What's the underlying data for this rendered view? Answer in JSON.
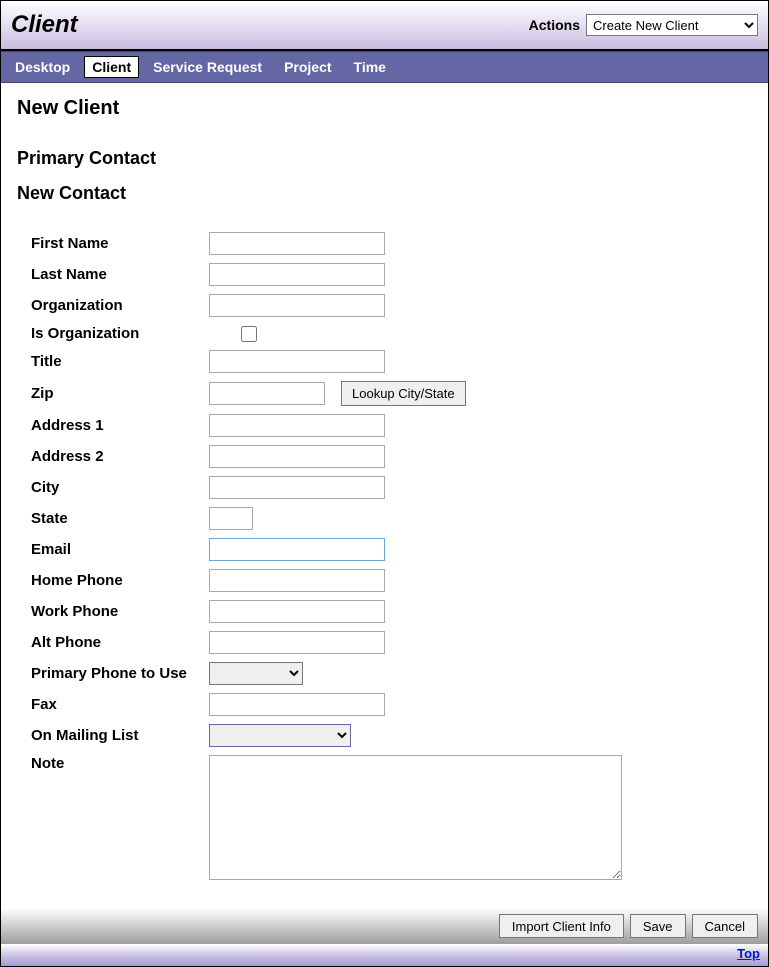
{
  "header": {
    "title": "Client",
    "actions_label": "Actions",
    "actions_selected": "Create New Client"
  },
  "nav": {
    "items": [
      {
        "label": "Desktop",
        "active": false
      },
      {
        "label": "Client",
        "active": true
      },
      {
        "label": "Service Request",
        "active": false
      },
      {
        "label": "Project",
        "active": false
      },
      {
        "label": "Time",
        "active": false
      }
    ]
  },
  "page": {
    "h_new_client": "New Client",
    "h_primary_contact": "Primary Contact",
    "h_new_contact": "New Contact"
  },
  "form": {
    "first_name": {
      "label": "First Name",
      "value": ""
    },
    "last_name": {
      "label": "Last Name",
      "value": ""
    },
    "organization": {
      "label": "Organization",
      "value": ""
    },
    "is_organization": {
      "label": "Is Organization"
    },
    "title": {
      "label": "Title",
      "value": ""
    },
    "zip": {
      "label": "Zip",
      "value": "",
      "lookup_button": "Lookup City/State"
    },
    "address1": {
      "label": "Address 1",
      "value": ""
    },
    "address2": {
      "label": "Address 2",
      "value": ""
    },
    "city": {
      "label": "City",
      "value": ""
    },
    "state": {
      "label": "State",
      "value": ""
    },
    "email": {
      "label": "Email",
      "value": ""
    },
    "home_phone": {
      "label": "Home Phone",
      "value": ""
    },
    "work_phone": {
      "label": "Work Phone",
      "value": ""
    },
    "alt_phone": {
      "label": "Alt Phone",
      "value": ""
    },
    "primary_phone": {
      "label": "Primary Phone to Use",
      "value": ""
    },
    "fax": {
      "label": "Fax",
      "value": ""
    },
    "mailing_list": {
      "label": "On Mailing List",
      "value": ""
    },
    "note": {
      "label": "Note",
      "value": ""
    }
  },
  "footer": {
    "import_button": "Import Client Info",
    "save_button": "Save",
    "cancel_button": "Cancel"
  },
  "bottom": {
    "top_link": "Top"
  }
}
